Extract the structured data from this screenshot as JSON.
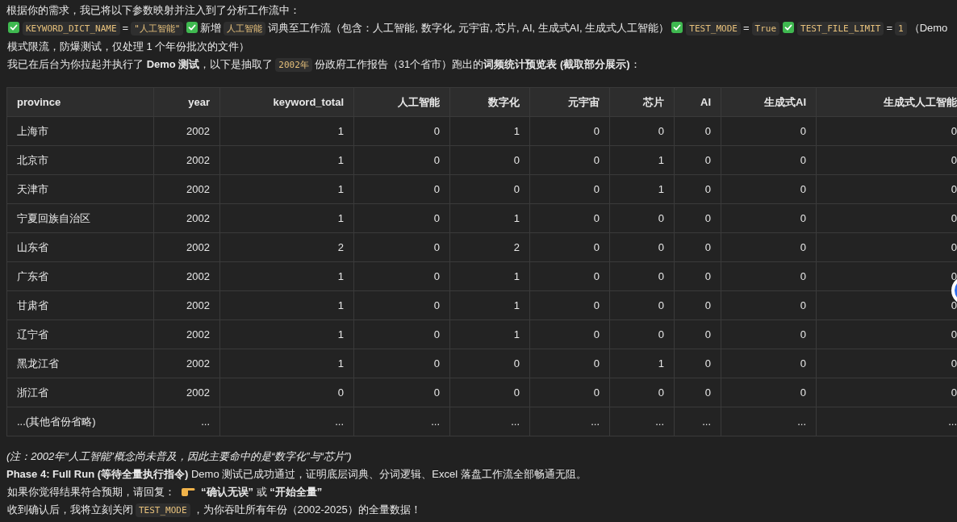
{
  "intro": "根据你的需求，我已将以下参数映射并注入到了分析工作流中：",
  "params": [
    {
      "kind": "check"
    },
    {
      "kind": "code",
      "text": "KEYWORD_DICT_NAME"
    },
    {
      "kind": "text",
      "text": "="
    },
    {
      "kind": "code",
      "text": "\"人工智能\""
    },
    {
      "kind": "check"
    },
    {
      "kind": "text",
      "text": "新增"
    },
    {
      "kind": "code",
      "text": "人工智能"
    },
    {
      "kind": "text",
      "text": "词典至工作流（包含：人工智能, 数字化, 元宇宙, 芯片, AI, 生成式AI, 生成式人工智能）"
    },
    {
      "kind": "check"
    },
    {
      "kind": "code",
      "text": "TEST_MODE"
    },
    {
      "kind": "text",
      "text": "="
    },
    {
      "kind": "code",
      "text": "True"
    },
    {
      "kind": "check"
    },
    {
      "kind": "code",
      "text": "TEST_FILE_LIMIT"
    },
    {
      "kind": "text",
      "text": "="
    },
    {
      "kind": "code",
      "text": "1"
    },
    {
      "kind": "text",
      "text": "（Demo"
    },
    {
      "kind": "text",
      "text": "模式限流，防爆测试，仅处理 1 个年份批次的文件）"
    }
  ],
  "summary": [
    {
      "kind": "text",
      "text": "我已在后台为你拉起并执行了 **Demo 测试**，以下是抽取了"
    },
    {
      "kind": "code",
      "text": "2002年"
    },
    {
      "kind": "text",
      "text": "份政府工作报告（31个省市）跑出的**词频统计预览表 (截取部分展示)**："
    }
  ],
  "table": {
    "columns": [
      "province",
      "year",
      "keyword_total",
      "人工智能",
      "数字化",
      "元宇宙",
      "芯片",
      "AI",
      "生成式AI",
      "生成式人工智能"
    ],
    "rows": [
      [
        "上海市",
        "2002",
        "1",
        "0",
        "1",
        "0",
        "0",
        "0",
        "0",
        "0"
      ],
      [
        "北京市",
        "2002",
        "1",
        "0",
        "0",
        "0",
        "1",
        "0",
        "0",
        "0"
      ],
      [
        "天津市",
        "2002",
        "1",
        "0",
        "0",
        "0",
        "1",
        "0",
        "0",
        "0"
      ],
      [
        "宁夏回族自治区",
        "2002",
        "1",
        "0",
        "1",
        "0",
        "0",
        "0",
        "0",
        "0"
      ],
      [
        "山东省",
        "2002",
        "2",
        "0",
        "2",
        "0",
        "0",
        "0",
        "0",
        "0"
      ],
      [
        "广东省",
        "2002",
        "1",
        "0",
        "1",
        "0",
        "0",
        "0",
        "0",
        "0"
      ],
      [
        "甘肃省",
        "2002",
        "1",
        "0",
        "1",
        "0",
        "0",
        "0",
        "0",
        "0"
      ],
      [
        "辽宁省",
        "2002",
        "1",
        "0",
        "1",
        "0",
        "0",
        "0",
        "0",
        "0"
      ],
      [
        "黑龙江省",
        "2002",
        "1",
        "0",
        "0",
        "0",
        "1",
        "0",
        "0",
        "0"
      ],
      [
        "浙江省",
        "2002",
        "0",
        "0",
        "0",
        "0",
        "0",
        "0",
        "0",
        "0"
      ],
      [
        "...(其他省份省略)",
        "...",
        "...",
        "...",
        "...",
        "...",
        "...",
        "...",
        "...",
        "..."
      ]
    ]
  },
  "note": "(注：2002年“人工智能”概念尚未普及，因此主要命中的是“数字化”与“芯片”)",
  "phase": "**Phase 4: Full Run (等待全量执行指令)** Demo 测试已成功通过，证明底层词典、分词逻辑、Excel 落盘工作流全部畅通无阻。",
  "reply": [
    {
      "kind": "text",
      "text": "如果你觉得结果符合预期，请回复："
    },
    {
      "kind": "hand"
    },
    {
      "kind": "text",
      "text": "**“确认无误”** 或 **“开始全量”**"
    }
  ],
  "closing": [
    {
      "kind": "text",
      "text": "收到确认后，我将立刻关闭"
    },
    {
      "kind": "code",
      "text": "TEST_MODE"
    },
    {
      "kind": "text",
      "text": "，为你吞吐所有年份（2002-2025）的全量数据！"
    }
  ]
}
